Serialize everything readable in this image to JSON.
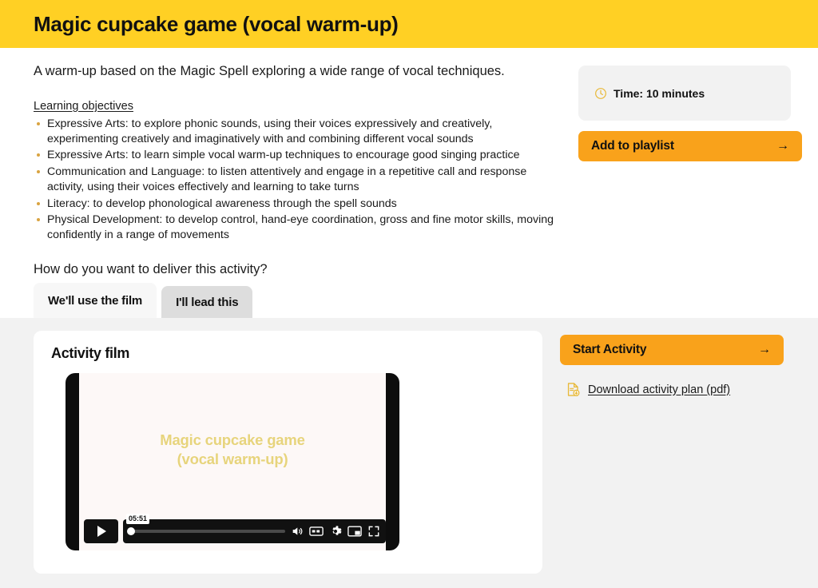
{
  "header": {
    "title": "Magic cupcake game (vocal warm-up)",
    "background_color": "#ffd024"
  },
  "main": {
    "intro": "A warm-up based on the Magic Spell exploring a wide range of vocal techniques.",
    "learning_objectives_title": "Learning objectives",
    "learning_objectives": [
      "Expressive Arts: to explore phonic sounds, using their voices expressively and creatively, experimenting creatively and imaginatively with and combining different vocal sounds",
      "Expressive Arts: to learn simple vocal warm-up techniques to encourage good singing practice",
      "Communication and Language: to listen attentively and engage in a repetitive call and response activity, using their voices effectively and learning to take turns",
      "Literacy: to develop phonological awareness through the spell sounds",
      "Physical Development: to develop control, hand-eye coordination, gross and fine motor skills, moving confidently in a range of movements"
    ],
    "delivery_question": "How do you want to deliver this activity?",
    "bullet_color": "#d9a441"
  },
  "tabs": [
    {
      "label": "We'll use the film",
      "active": true
    },
    {
      "label": "I'll lead this",
      "active": false
    }
  ],
  "sidebar": {
    "time_icon": "clock-icon",
    "time_label": "Time: 10 minutes",
    "add_to_playlist_label": "Add to playlist",
    "add_to_playlist_arrow": "→",
    "start_activity_label": "Start Activity",
    "start_activity_arrow": "→",
    "download_icon": "pdf-download-icon",
    "download_label": "Download activity plan (pdf)",
    "cta_color": "#f9a21b"
  },
  "film_panel": {
    "card_title": "Activity film",
    "video_title_line1": "Magic cupcake game",
    "video_title_line2": "(vocal warm-up)",
    "video_title_color": "#e7d47c",
    "player": {
      "play_icon": "play-icon",
      "time_tooltip": "05:51",
      "volume_icon": "volume-icon",
      "captions_icon": "closed-captions-icon",
      "settings_icon": "gear-icon",
      "pip_icon": "picture-in-picture-icon",
      "fullscreen_icon": "fullscreen-icon"
    }
  }
}
